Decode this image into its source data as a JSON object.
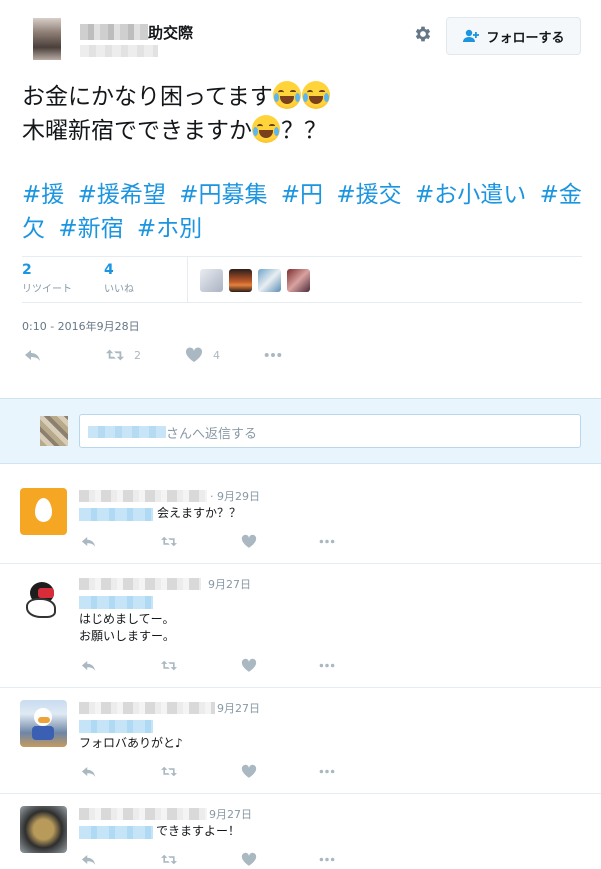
{
  "header": {
    "name_suffix": "助交際",
    "follow_label": "フォローする"
  },
  "tweet": {
    "lines": [
      "お金にかなり困ってます",
      "木曜新宿でできますか"
    ],
    "line2_suffix": "？？",
    "hashtags": [
      "#援",
      "#援希望",
      "#円募集",
      "#円",
      "#援交",
      "#お小遣い",
      "#金欠",
      "#新宿",
      "#ホ別"
    ],
    "retweets_count": "2",
    "retweets_label": "リツイート",
    "likes_count": "4",
    "likes_label": "いいね",
    "timestamp": "0:10 - 2016年9月28日",
    "action_retweet_count": "2",
    "action_like_count": "4"
  },
  "reply_box": {
    "placeholder": "さんへ返信する"
  },
  "replies": [
    {
      "date": "· 9月29日",
      "text": "会えますか？？"
    },
    {
      "date": "9月27日",
      "text": "はじめましてー。\nお願いしますー。"
    },
    {
      "date": "9月27日",
      "text": "フォロバありがと♪"
    },
    {
      "date": "9月27日",
      "text": "できますよー！"
    }
  ],
  "colors": {
    "link": "#1b95e0",
    "icon": "#aab8c2",
    "reply_bar_bg": "#e8f5fd"
  },
  "icons": [
    "gear-icon",
    "follow-user-icon",
    "reply-icon",
    "retweet-icon",
    "like-icon",
    "more-icon",
    "face-with-tears-of-joy-emoji"
  ]
}
